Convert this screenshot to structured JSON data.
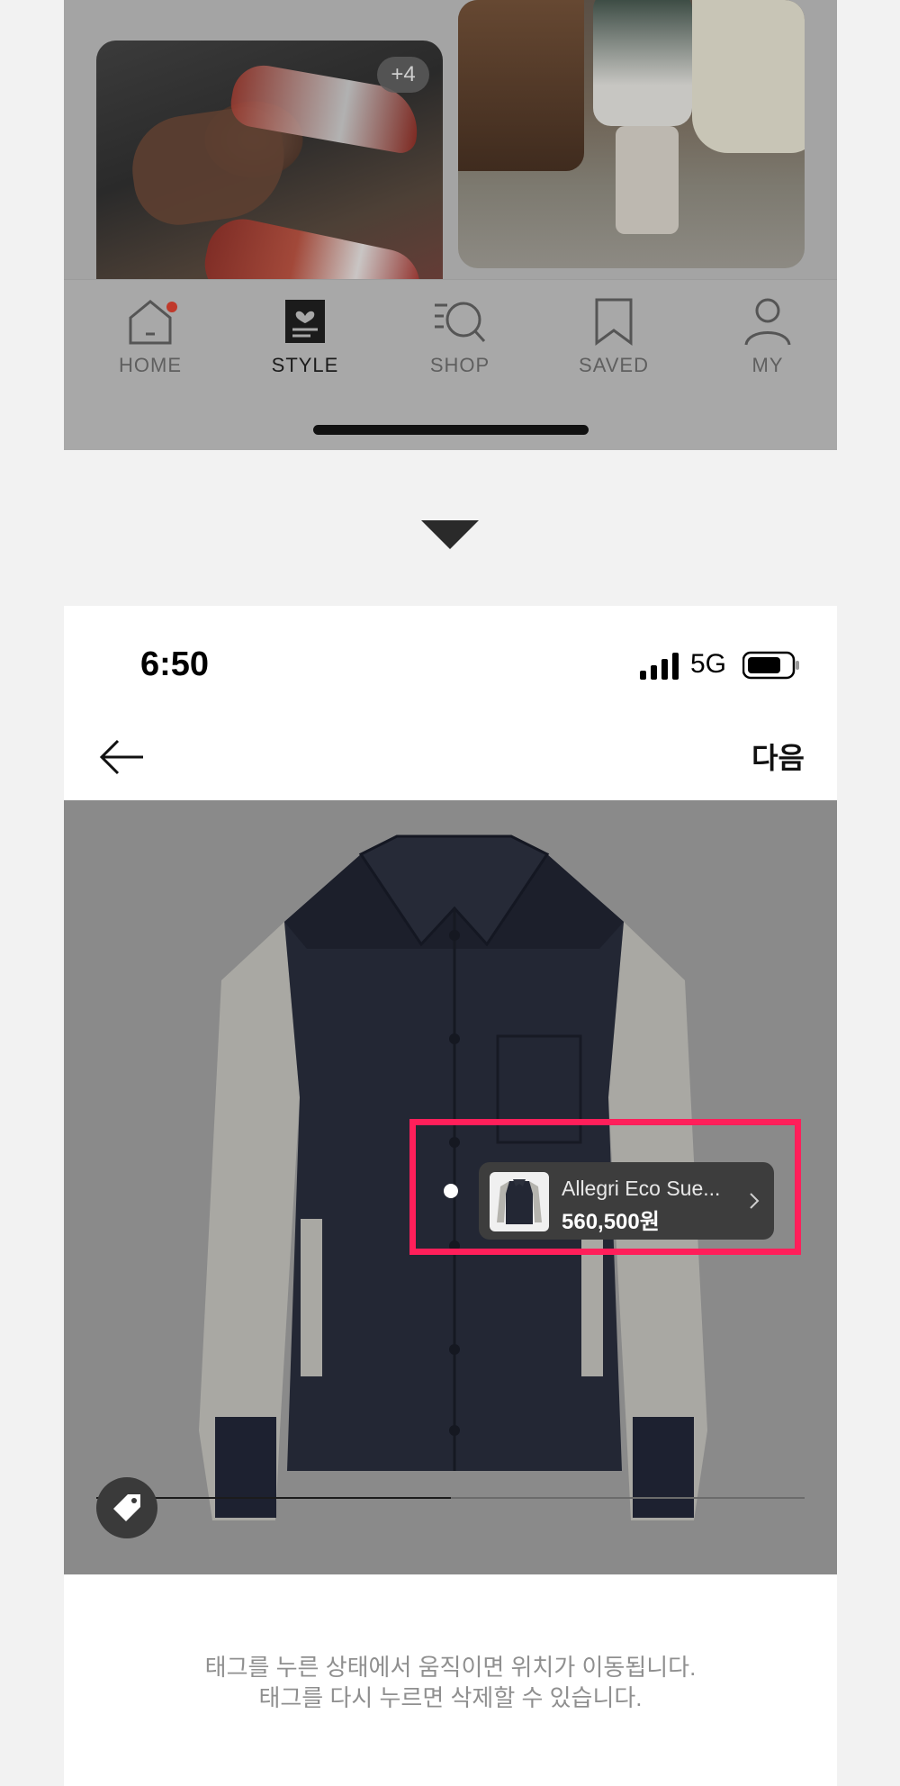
{
  "previous_screen": {
    "photo_badge": "+4",
    "tabs": [
      {
        "label": "HOME",
        "icon": "home-icon",
        "has_notification": true
      },
      {
        "label": "STYLE",
        "icon": "style-icon",
        "active": true
      },
      {
        "label": "SHOP",
        "icon": "shop-search-icon"
      },
      {
        "label": "SAVED",
        "icon": "bookmark-icon"
      },
      {
        "label": "MY",
        "icon": "person-icon"
      }
    ]
  },
  "status_bar": {
    "time": "6:50",
    "network": "5G"
  },
  "header": {
    "back_icon": "arrow-left-icon",
    "next_label": "다음"
  },
  "product_tag": {
    "name": "Allegri Eco Sue...",
    "price": "560,500원"
  },
  "image_progress": 0.5,
  "help_text": {
    "line1": "태그를 누른 상태에서 움직이면 위치가 이동됩니다.",
    "line2": "태그를 다시 누르면 삭제할 수 있습니다."
  },
  "colors": {
    "highlight": "#ff1f5a",
    "notification": "#c0392b"
  }
}
